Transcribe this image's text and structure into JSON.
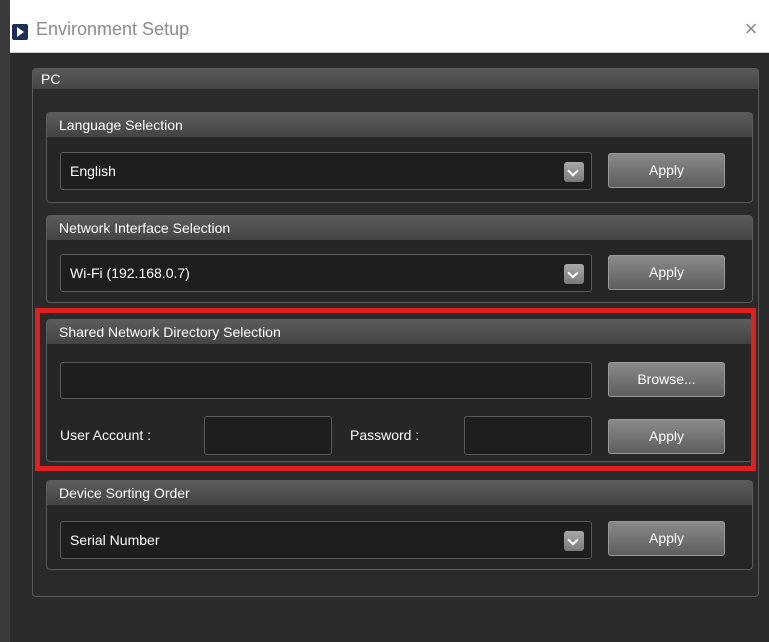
{
  "window": {
    "title": "Environment Setup",
    "close_glyph": "×",
    "icon": "app-play-icon"
  },
  "pc_group": {
    "label": "PC"
  },
  "language": {
    "header": "Language Selection",
    "selected": "English",
    "apply_label": "Apply"
  },
  "network_interface": {
    "header": "Network Interface Selection",
    "selected": "Wi-Fi (192.168.0.7)",
    "apply_label": "Apply"
  },
  "shared_directory": {
    "header": "Shared Network Directory Selection",
    "path_value": "",
    "browse_label": "Browse...",
    "user_account_label": "User Account :",
    "user_account_value": "",
    "password_label": "Password :",
    "password_value": "",
    "apply_label": "Apply"
  },
  "device_sorting": {
    "header": "Device Sorting Order",
    "selected": "Serial Number",
    "apply_label": "Apply"
  },
  "colors": {
    "window_bg": "#2b2b2b",
    "highlight": "#e02020",
    "button": "#6e6e6e"
  }
}
